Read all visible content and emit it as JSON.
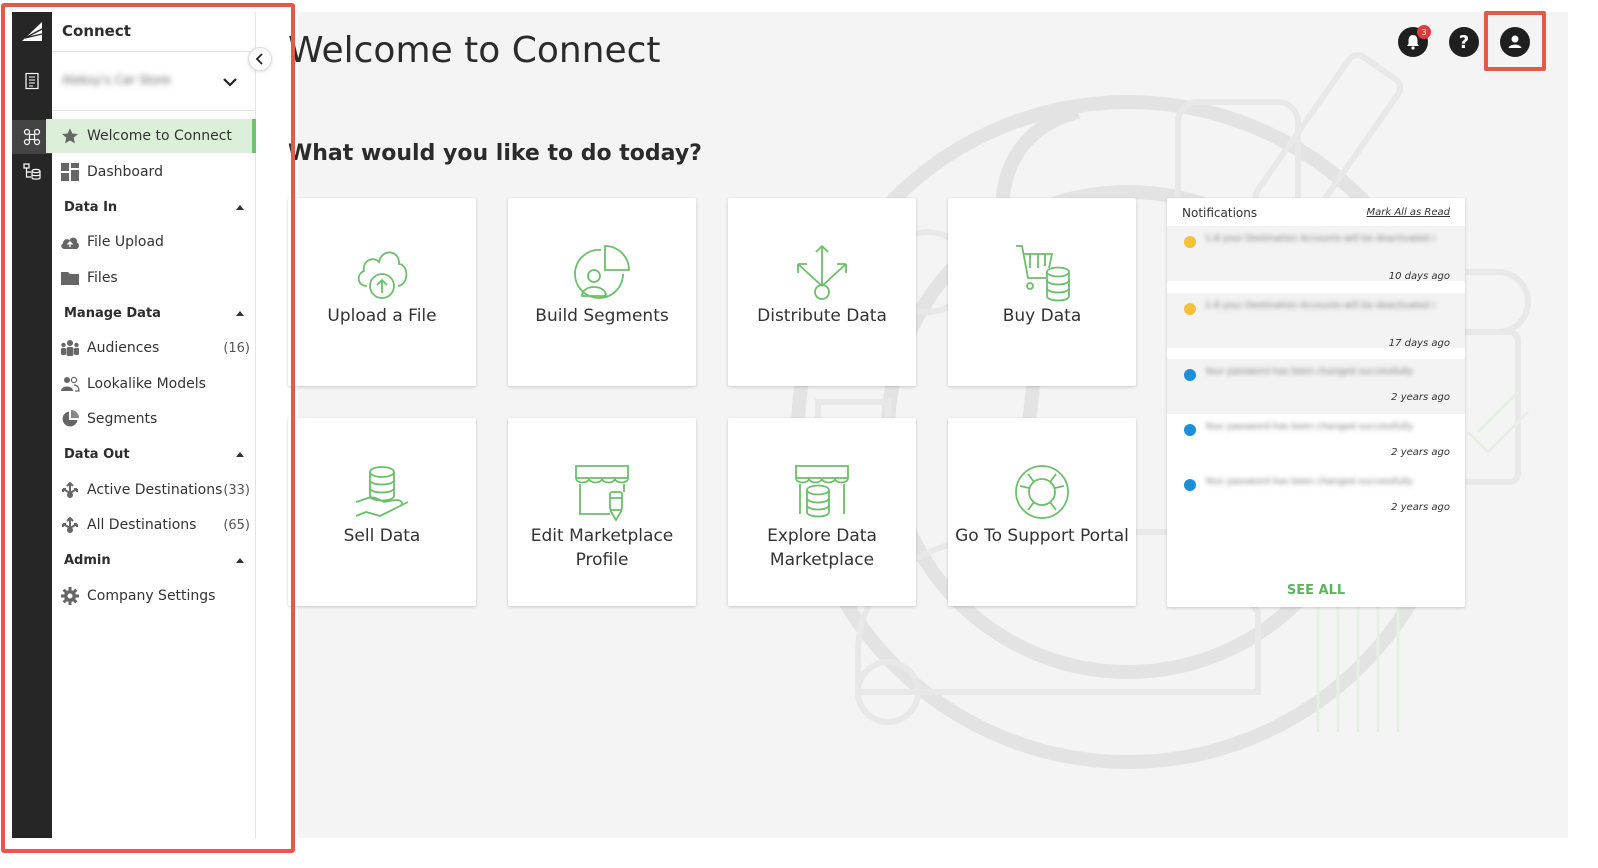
{
  "app": {
    "title": "Connect",
    "account_name": "Aleksy's Car Store"
  },
  "sidebar": {
    "items": [
      {
        "label": "Welcome to Connect",
        "icon": "star-icon"
      },
      {
        "label": "Dashboard",
        "icon": "dashboard-icon"
      }
    ],
    "sections": [
      {
        "title": "Data In",
        "items": [
          {
            "label": "File Upload",
            "icon": "cloud-upload-icon",
            "count": ""
          },
          {
            "label": "Files",
            "icon": "folder-icon",
            "count": ""
          }
        ]
      },
      {
        "title": "Manage Data",
        "items": [
          {
            "label": "Audiences",
            "icon": "people-icon",
            "count": "(16)"
          },
          {
            "label": "Lookalike Models",
            "icon": "lookalike-icon",
            "count": ""
          },
          {
            "label": "Segments",
            "icon": "pie-icon",
            "count": ""
          }
        ]
      },
      {
        "title": "Data Out",
        "items": [
          {
            "label": "Active Destinations",
            "icon": "distribute-icon",
            "count": "(33)"
          },
          {
            "label": "All Destinations",
            "icon": "distribute-icon",
            "count": "(65)"
          }
        ]
      },
      {
        "title": "Admin",
        "items": [
          {
            "label": "Company Settings",
            "icon": "gear-icon",
            "count": ""
          }
        ]
      }
    ]
  },
  "header": {
    "title": "Welcome to Connect",
    "subtitle": "What would you like to do today?",
    "notification_count": "3"
  },
  "tiles": [
    {
      "label": "Upload a File",
      "icon": "cloud-upload-icon"
    },
    {
      "label": "Build Segments",
      "icon": "segments-icon"
    },
    {
      "label": "Distribute Data",
      "icon": "distribute-icon"
    },
    {
      "label": "Buy Data",
      "icon": "cart-database-icon"
    },
    {
      "label": "Sell Data",
      "icon": "hand-database-icon"
    },
    {
      "label": "Edit Marketplace Profile",
      "icon": "storefront-edit-icon"
    },
    {
      "label": "Explore Data Marketplace",
      "icon": "storefront-database-icon"
    },
    {
      "label": "Go To Support Portal",
      "icon": "lifebuoy-icon"
    }
  ],
  "notifications": {
    "title": "Notifications",
    "mark_all": "Mark All as Read",
    "see_all": "SEE ALL",
    "items": [
      {
        "type": "warning",
        "text": "1-8 your Destination Accounts will be deactivated soon",
        "time": "10 days ago"
      },
      {
        "type": "warning",
        "text": "1-8 your Destination Accounts will be deactivated soon",
        "time": "17 days ago"
      },
      {
        "type": "info",
        "text": "Your password has been changed successfully",
        "time": "2 years ago"
      },
      {
        "type": "info",
        "text": "Your password has been changed successfully",
        "time": "2 years ago"
      },
      {
        "type": "info",
        "text": "Your password has been changed successfully",
        "time": "2 years ago"
      }
    ]
  },
  "colors": {
    "accent": "#71c26d",
    "highlight": "#e8584a",
    "rail": "#262626",
    "badge": "#e03b3b"
  }
}
